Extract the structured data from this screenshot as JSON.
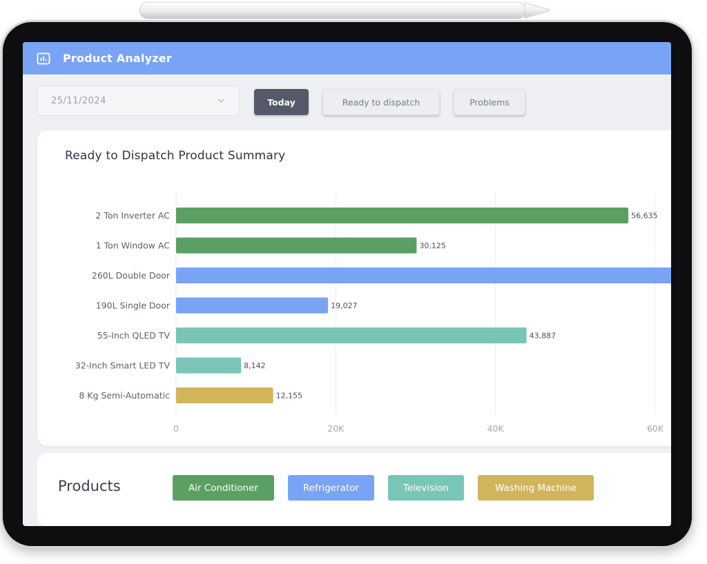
{
  "app": {
    "title": "Product Analyzer",
    "header_color": "#79a3f4"
  },
  "toolbar": {
    "date_value": "25/11/2024",
    "buttons": [
      {
        "label": "Today",
        "active": true
      },
      {
        "label": "Ready to dispatch",
        "active": false
      },
      {
        "label": "Problems",
        "active": false
      }
    ]
  },
  "chart_data": {
    "type": "bar",
    "orientation": "horizontal",
    "title": "Ready to Dispatch Product Summary",
    "categories": [
      "2 Ton Inverter AC",
      "1 Ton Window AC",
      "260L Double Door",
      "190L Single Door",
      "55-Inch QLED TV",
      "32-Inch Smart LED TV",
      "8 Kg Semi-Automatic"
    ],
    "values": [
      56635,
      30125,
      63000,
      19027,
      43887,
      8142,
      12155
    ],
    "value_labels": [
      "56,635",
      "30,125",
      "",
      "19,027",
      "43,887",
      "8,142",
      "12,155"
    ],
    "groups": [
      "Air Conditioner",
      "Air Conditioner",
      "Refrigerator",
      "Refrigerator",
      "Television",
      "Television",
      "Washing Machine"
    ],
    "xlim": [
      0,
      60000
    ],
    "x_ticks": [
      {
        "value": 0,
        "label": "0"
      },
      {
        "value": 20000,
        "label": "20K"
      },
      {
        "value": 40000,
        "label": "40K"
      },
      {
        "value": 60000,
        "label": "60K"
      }
    ],
    "grid": true
  },
  "products": {
    "label": "Products",
    "items": [
      {
        "label": "Air Conditioner",
        "color": "#5b9f62"
      },
      {
        "label": "Refrigerator",
        "color": "#79a3f4"
      },
      {
        "label": "Television",
        "color": "#79c5b8"
      },
      {
        "label": "Washing Machine",
        "color": "#d1b55a"
      }
    ]
  }
}
